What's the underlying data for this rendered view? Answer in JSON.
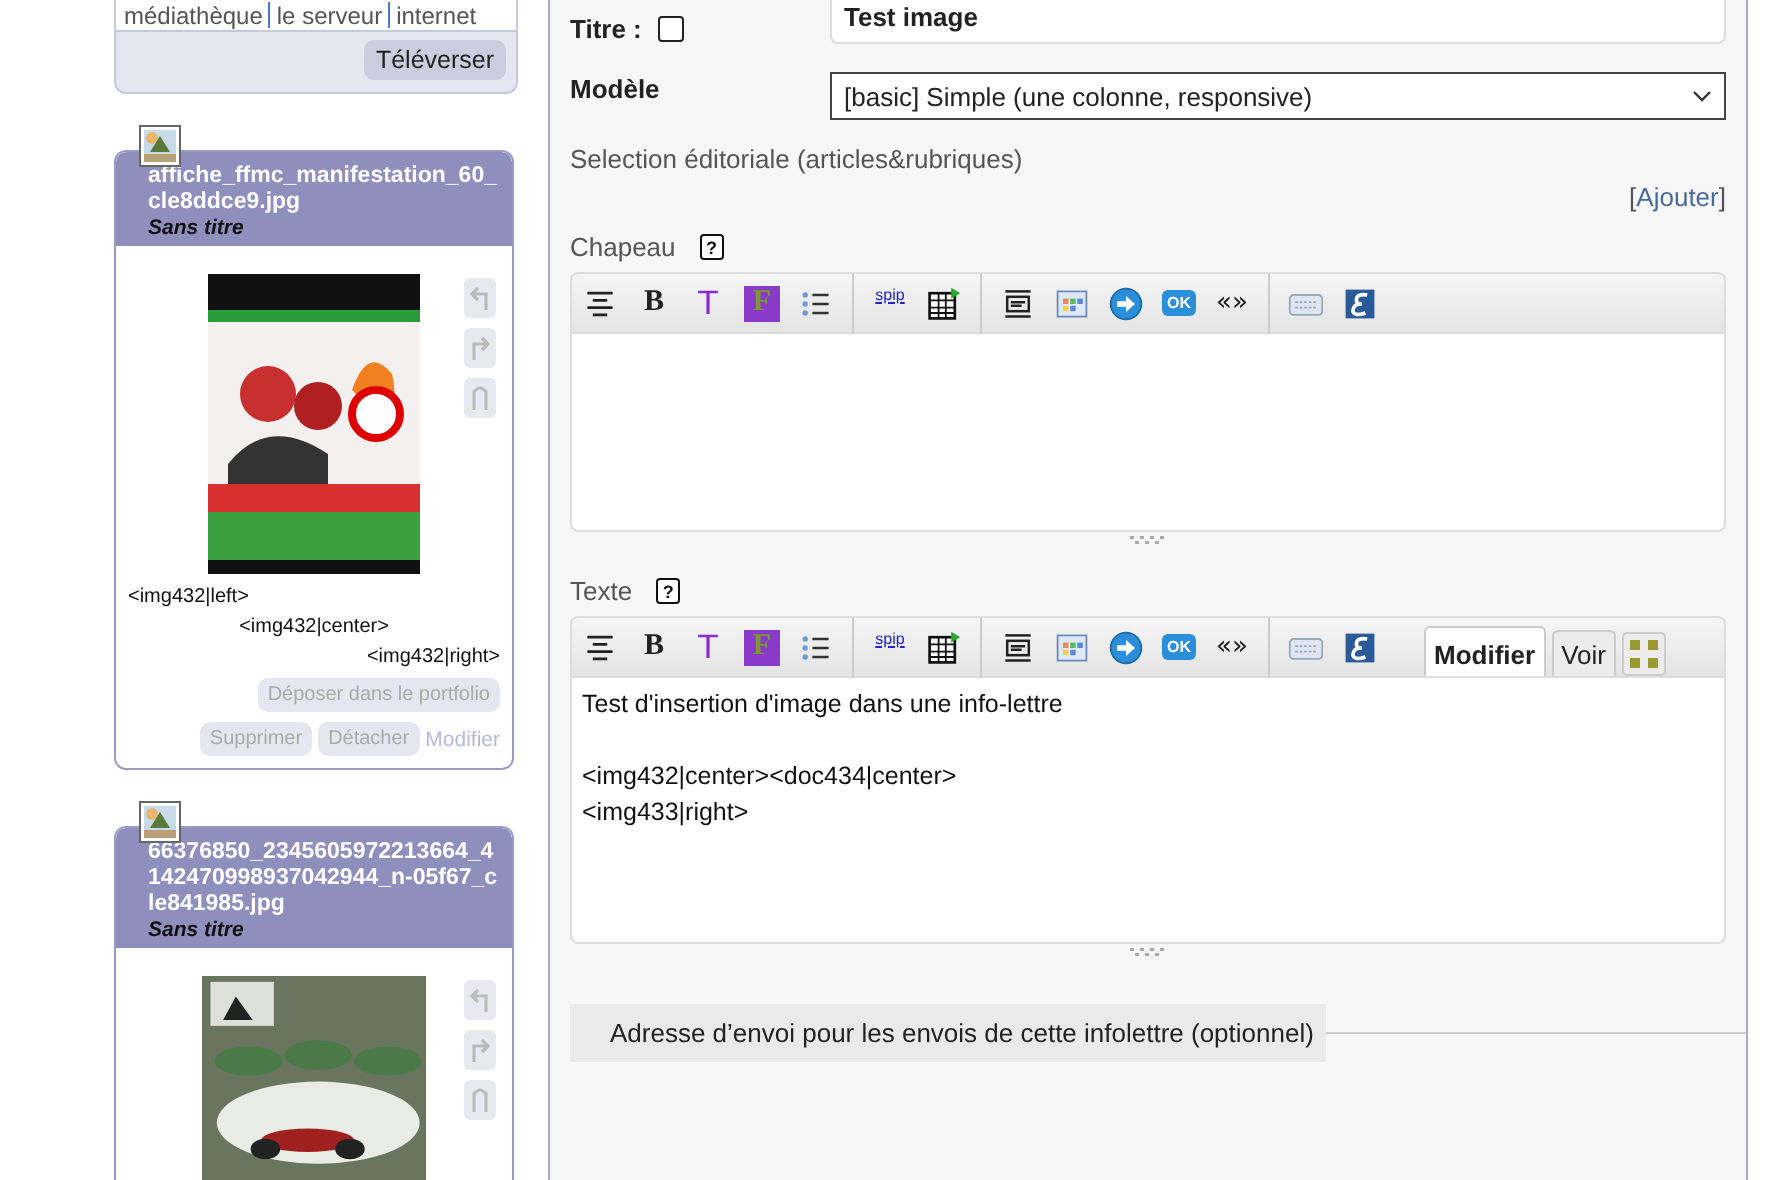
{
  "upload_box": {
    "sources": [
      "médiathèque",
      "le serveur",
      "internet"
    ],
    "upload_button": "Téléverser"
  },
  "documents": [
    {
      "filename": "affiche_ffmc_manifestation_60_cle8ddce9.jpg",
      "title": "Sans titre",
      "picture": {
        "kind": "picture"
      },
      "shortcuts": [
        "<img432|left>",
        "<img432|center>",
        "<img432|right>"
      ],
      "buttons": [
        {
          "label": "Déposer dans le portfolio",
          "kind": "button"
        },
        {
          "label": "Supprimer",
          "kind": "button"
        },
        {
          "label": "Détacher",
          "kind": "button"
        },
        {
          "label": "Modifier",
          "kind": "link"
        }
      ]
    },
    {
      "filename": "66376850_2345605972213664_4142470998937042944_n-05f67_cle841985.jpg",
      "title": "Sans titre",
      "picture": {
        "kind": "picture"
      }
    }
  ],
  "form": {
    "title_label": "Titre :",
    "title_value": "Test image",
    "model_label": "Modèle",
    "model_value": "[basic] Simple (une colonne, responsive)",
    "selection_label": "Selection éditoriale (articles&rubriques)",
    "add_link": {
      "open": "[",
      "label": "Ajouter",
      "close": "]"
    },
    "editors": [
      {
        "label": "Chapeau",
        "help": "?",
        "toolbar": [
          {
            "kind": "align"
          },
          {
            "kind": "bold",
            "text": "B"
          },
          {
            "kind": "type",
            "text": "T"
          },
          {
            "kind": "fill",
            "text": "F"
          },
          {
            "kind": "list"
          },
          {
            "kind": "sep"
          },
          {
            "kind": "spip",
            "text": "spip"
          },
          {
            "kind": "table"
          },
          {
            "kind": "sep"
          },
          {
            "kind": "para"
          },
          {
            "kind": "calendar"
          },
          {
            "kind": "arrow"
          },
          {
            "kind": "ok",
            "text": "OK"
          },
          {
            "kind": "quote",
            "text": "«»"
          },
          {
            "kind": "sep"
          },
          {
            "kind": "keyboard"
          },
          {
            "kind": "logo"
          }
        ]
      },
      {
        "label": "Texte",
        "help": "?",
        "toolbar": [
          {
            "kind": "align"
          },
          {
            "kind": "bold",
            "text": "B"
          },
          {
            "kind": "type",
            "text": "T"
          },
          {
            "kind": "fill",
            "text": "F"
          },
          {
            "kind": "list"
          },
          {
            "kind": "sep"
          },
          {
            "kind": "spip",
            "text": "spip"
          },
          {
            "kind": "table"
          },
          {
            "kind": "sep"
          },
          {
            "kind": "para"
          },
          {
            "kind": "calendar"
          },
          {
            "kind": "arrow"
          },
          {
            "kind": "ok",
            "text": "OK"
          },
          {
            "kind": "quote",
            "text": "«»"
          },
          {
            "kind": "sep"
          },
          {
            "kind": "keyboard"
          },
          {
            "kind": "logo"
          }
        ],
        "paragraphs": [
          [
            "Test d'insertion d'image dans une info-lettre"
          ],
          [
            "<img432|center><doc434|center>",
            "<img433|right>"
          ]
        ],
        "tabs": [
          {
            "label": "Modifier",
            "selected": true
          },
          {
            "label": "Voir",
            "selected": false
          }
        ]
      }
    ],
    "fieldset_legend": "Adresse d’envoi pour les envois de cette infolettre (optionnel)"
  }
}
